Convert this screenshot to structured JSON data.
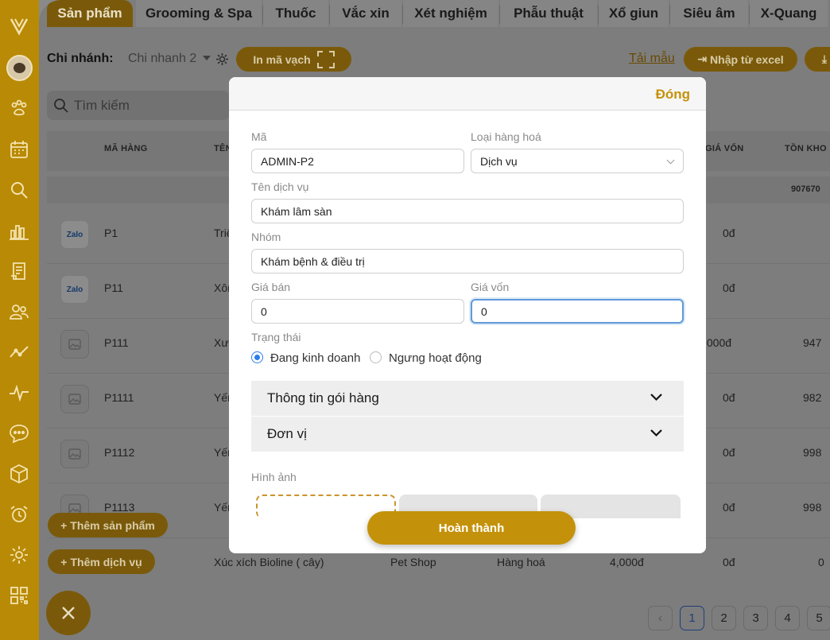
{
  "tabs": [
    "Sản phẩm",
    "Grooming & Spa",
    "Thuốc",
    "Vắc xin",
    "Xét nghiệm",
    "Phẫu thuật",
    "Xổ giun",
    "Siêu âm",
    "X-Quang"
  ],
  "sidebar": {
    "icons": [
      "logo-icon",
      "paw-icon",
      "calendar-icon",
      "search-icon",
      "bar-chart-icon",
      "document-icon",
      "users-icon",
      "trend-icon",
      "pulse-icon",
      "chat-icon",
      "box-icon",
      "alarm-icon",
      "settings-icon",
      "qr-icon"
    ]
  },
  "toolbar": {
    "branch_label": "Chi nhánh:",
    "branch_value": "Chi nhanh 2",
    "barcode_label": "In mã vạch",
    "template_link": "Tải mẫu",
    "import_label": "Nhập từ excel"
  },
  "search": {
    "placeholder": "Tìm kiếm"
  },
  "table": {
    "headers": {
      "code": "MÃ HÀNG",
      "name": "TÊN",
      "cost": "GIÁ VỐN",
      "stock": "TỒN KHO"
    },
    "total_stock": "907670",
    "rows": [
      {
        "code": "P1",
        "name": "Triệ",
        "price": "",
        "cost": "0đ",
        "stock": "",
        "thumb": "zalo"
      },
      {
        "code": "P11",
        "name": "Xôn",
        "price": "",
        "cost": "0đ",
        "stock": "",
        "thumb": "zalo"
      },
      {
        "code": "P111",
        "name": "Xư",
        "price": "",
        "cost": ",000đ",
        "stock": "947",
        "thumb": "image"
      },
      {
        "code": "P1111",
        "name": "Yến",
        "price": "",
        "cost": "0đ",
        "stock": "982",
        "thumb": "image"
      },
      {
        "code": "P1112",
        "name": "Yến",
        "price": "",
        "cost": "0đ",
        "stock": "998",
        "thumb": "image"
      },
      {
        "code": "P1113",
        "name": "Yến",
        "price": "",
        "cost": "0đ",
        "stock": "998",
        "thumb": "image"
      }
    ],
    "last_row": {
      "name": "Xúc xích Bioline ( cây)",
      "group": "Pet Shop",
      "type": "Hàng hoá",
      "price": "4,000đ",
      "cost": "0đ",
      "stock": "0"
    }
  },
  "actions": {
    "add_product": "Thêm sản phẩm",
    "add_service": "Thêm dịch vụ"
  },
  "pagination": {
    "pages": [
      "1",
      "2",
      "3",
      "4",
      "5"
    ],
    "current": "1"
  },
  "modal": {
    "close_label": "Đóng",
    "code_label": "Mã",
    "code_value": "ADMIN-P2",
    "type_label": "Loại hàng hoá",
    "type_value": "Dịch vụ",
    "name_label": "Tên dịch vụ",
    "name_value": "Khám lâm sàn",
    "group_label": "Nhóm",
    "group_value": "Khám bệnh & điều trị",
    "sell_label": "Giá bán",
    "sell_value": "0",
    "cost_label": "Giá vốn",
    "cost_value": "0",
    "status_label": "Trạng thái",
    "status_active": "Đang kinh doanh",
    "status_inactive": "Ngưng hoạt động",
    "package_label": "Thông tin gói hàng",
    "unit_label": "Đơn vị",
    "image_label": "Hình ảnh",
    "complete_label": "Hoàn thành"
  },
  "colors": {
    "accent": "#c4920a",
    "sidebar": "#b98a05",
    "focus": "#5f9ad8"
  }
}
